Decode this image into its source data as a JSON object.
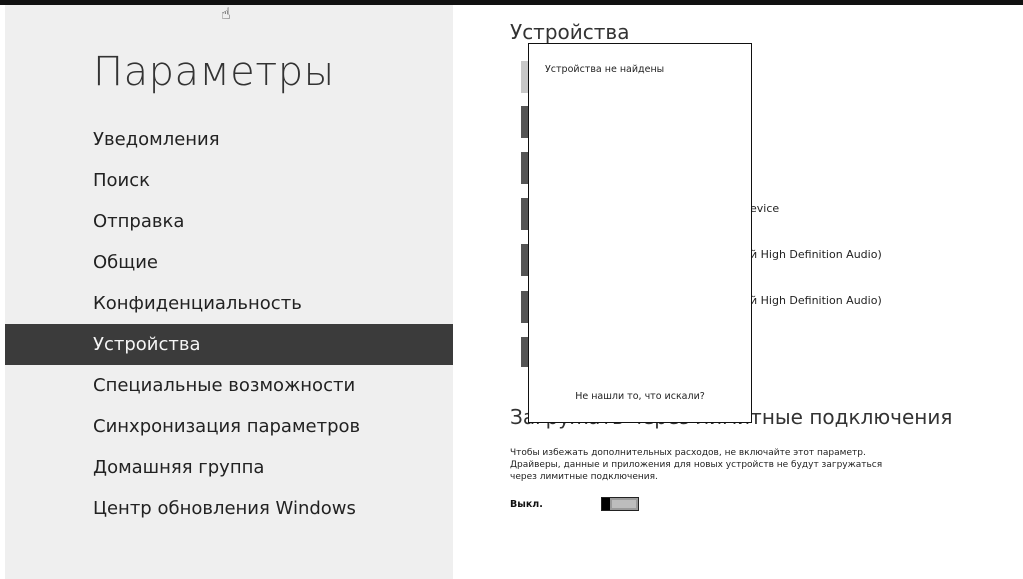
{
  "left_pane": {
    "title": "Параметры",
    "nav_items": [
      "Уведомления",
      "Поиск",
      "Отправка",
      "Общие",
      "Конфиденциальность",
      "Устройства",
      "Специальные возможности",
      "Синхронизация параметров",
      "Домашняя группа",
      "Центр обновления Windows"
    ],
    "active_item": "Устройства"
  },
  "devices": {
    "section_title": "Устройства",
    "visible_device_fragments": [
      "evice",
      "й High Definition Audio)",
      "й High Definition Audio)"
    ]
  },
  "popup": {
    "empty_message": "Устройства не найдены",
    "not_found_link": "Не нашли то, что искали?"
  },
  "metered": {
    "title": "Загружать через лимитные подключения",
    "description_lines": [
      "Чтобы избежать дополнительных расходов, не включайте этот параметр.",
      "Драйверы, данные и приложения для новых устройств не будут загружаться",
      "через лимитные подключения."
    ],
    "toggle_label": "Выкл.",
    "toggle_on": false
  },
  "colors": {
    "left_pane_bg": "#efefef",
    "active_item_bg": "#3b3b3b",
    "tile_dark": "#555555"
  }
}
